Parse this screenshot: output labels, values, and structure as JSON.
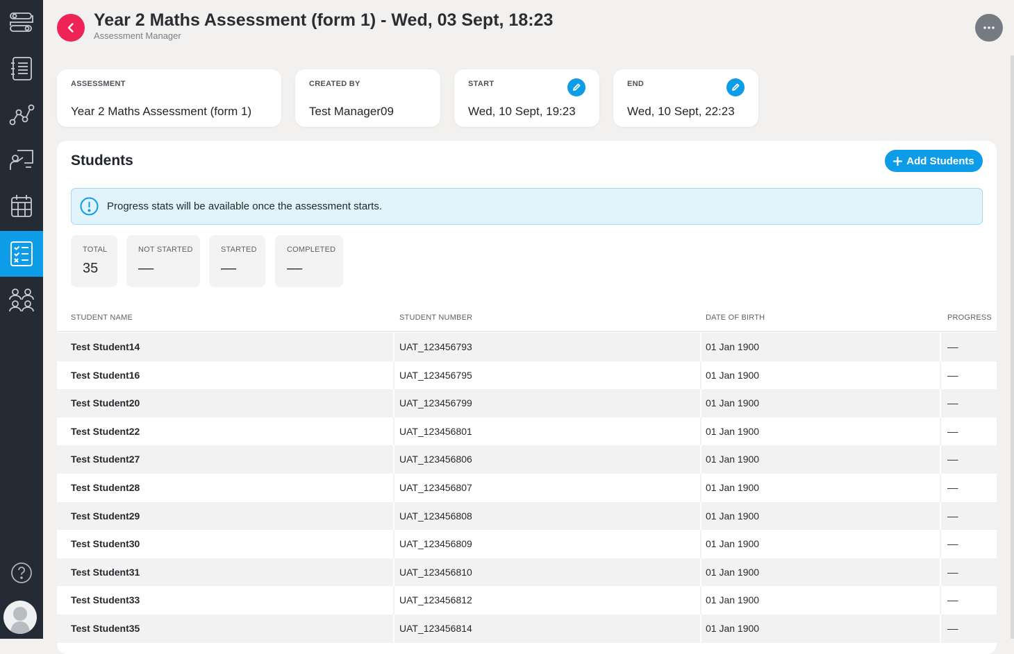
{
  "header": {
    "title": "Year 2 Maths Assessment (form 1) - Wed, 03 Sept, 18:23",
    "subtitle": "Assessment Manager"
  },
  "sidebar": {
    "items": [
      {
        "icon": "workflow-icon"
      },
      {
        "icon": "list-icon"
      },
      {
        "icon": "graph-icon"
      },
      {
        "icon": "presentation-icon"
      },
      {
        "icon": "calendar-icon"
      },
      {
        "icon": "checklist-icon",
        "active": true
      },
      {
        "icon": "people-icon"
      }
    ],
    "help_icon": "help-icon"
  },
  "info_cards": {
    "assessment": {
      "label": "ASSESSMENT",
      "value": "Year 2 Maths Assessment (form 1)"
    },
    "created_by": {
      "label": "CREATED BY",
      "value": "Test Manager09"
    },
    "start": {
      "label": "START",
      "value": "Wed, 10 Sept, 19:23"
    },
    "end": {
      "label": "END",
      "value": "Wed, 10 Sept, 22:23"
    }
  },
  "students": {
    "title": "Students",
    "add_button": "Add Students",
    "notice": "Progress stats will be available once the assessment starts.",
    "stats": {
      "total": {
        "label": "TOTAL",
        "value": "35"
      },
      "not_started": {
        "label": "NOT STARTED",
        "value": "––"
      },
      "started": {
        "label": "STARTED",
        "value": "––"
      },
      "completed": {
        "label": "COMPLETED",
        "value": "––"
      }
    },
    "columns": {
      "name": "STUDENT NAME",
      "number": "STUDENT NUMBER",
      "dob": "DATE OF BIRTH",
      "progress": "PROGRESS"
    },
    "rows": [
      {
        "name": "Test Student14",
        "number": "UAT_123456793",
        "dob": "01 Jan 1900",
        "progress": "––"
      },
      {
        "name": "Test Student16",
        "number": "UAT_123456795",
        "dob": "01 Jan 1900",
        "progress": "––"
      },
      {
        "name": "Test Student20",
        "number": "UAT_123456799",
        "dob": "01 Jan 1900",
        "progress": "––"
      },
      {
        "name": "Test Student22",
        "number": "UAT_123456801",
        "dob": "01 Jan 1900",
        "progress": "––"
      },
      {
        "name": "Test Student27",
        "number": "UAT_123456806",
        "dob": "01 Jan 1900",
        "progress": "––"
      },
      {
        "name": "Test Student28",
        "number": "UAT_123456807",
        "dob": "01 Jan 1900",
        "progress": "––"
      },
      {
        "name": "Test Student29",
        "number": "UAT_123456808",
        "dob": "01 Jan 1900",
        "progress": "––"
      },
      {
        "name": "Test Student30",
        "number": "UAT_123456809",
        "dob": "01 Jan 1900",
        "progress": "––"
      },
      {
        "name": "Test Student31",
        "number": "UAT_123456810",
        "dob": "01 Jan 1900",
        "progress": "––"
      },
      {
        "name": "Test Student33",
        "number": "UAT_123456812",
        "dob": "01 Jan 1900",
        "progress": "––"
      },
      {
        "name": "Test Student35",
        "number": "UAT_123456814",
        "dob": "01 Jan 1900",
        "progress": "––"
      }
    ]
  },
  "colors": {
    "accent": "#0d9ce8",
    "back_button": "#ee2457",
    "sidebar": "#242b35"
  }
}
